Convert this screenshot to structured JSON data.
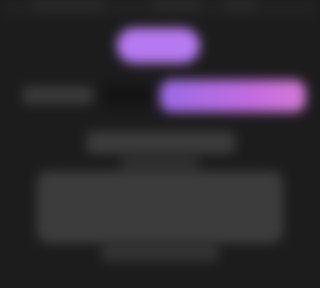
{
  "tabs": [
    "",
    "",
    ""
  ],
  "pill": {
    "label": ""
  },
  "row": {
    "label": "",
    "progress": 1.0
  },
  "card": {
    "title": "",
    "subtitle": "",
    "body": "",
    "footer": ""
  },
  "colors": {
    "background": "#1c1c1c",
    "accent_purple": "#b67af0",
    "progress_start": "#9a6be6",
    "progress_end": "#d47ad8"
  }
}
